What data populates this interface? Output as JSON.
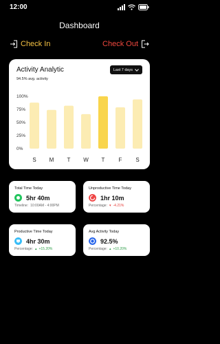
{
  "status_bar": {
    "time": "12:00"
  },
  "header": {
    "title": "Dashboard"
  },
  "actions": {
    "check_in": "Check In",
    "check_out": "Check Out"
  },
  "activity": {
    "title": "Activity Analytic",
    "subtitle": "94.5% avg. activity",
    "range": "Last 7 days",
    "chart_data": {
      "type": "bar",
      "categories": [
        "S",
        "M",
        "T",
        "W",
        "T",
        "F",
        "S"
      ],
      "values": [
        88,
        74,
        82,
        66,
        100,
        79,
        94
      ],
      "highlight_index": 4,
      "ylim": [
        0,
        100
      ],
      "yticks": [
        "100%",
        "75%",
        "50%",
        "25%",
        "0%"
      ],
      "colors": {
        "bar": "#fcecb3",
        "highlight": "#f9d54c"
      }
    }
  },
  "stats": {
    "total": {
      "title": "Total Time Today",
      "value": "5hr 40m",
      "foot_label": "Timeline:",
      "foot_value": "10:00AM - 4:00PM",
      "icon": "green-dot-icon",
      "color": "#22c55e"
    },
    "unproductive": {
      "title": "Unproductive Time Today",
      "value": "1hr 10m",
      "foot_label": "Percentage:",
      "foot_value": "-4.21%",
      "icon": "progress-ring-icon",
      "color": "#ef4444"
    },
    "productive": {
      "title": "Productive Time Today",
      "value": "4hr 30m",
      "foot_label": "Percentage:",
      "foot_value": "+15.20%",
      "icon": "monitor-icon",
      "color": "#38bdf8"
    },
    "activity": {
      "title": "Avg Activity Today",
      "value": "92.5%",
      "foot_label": "Percentage:",
      "foot_value": "+10.20%",
      "icon": "activity-icon",
      "color": "#2563eb"
    }
  }
}
